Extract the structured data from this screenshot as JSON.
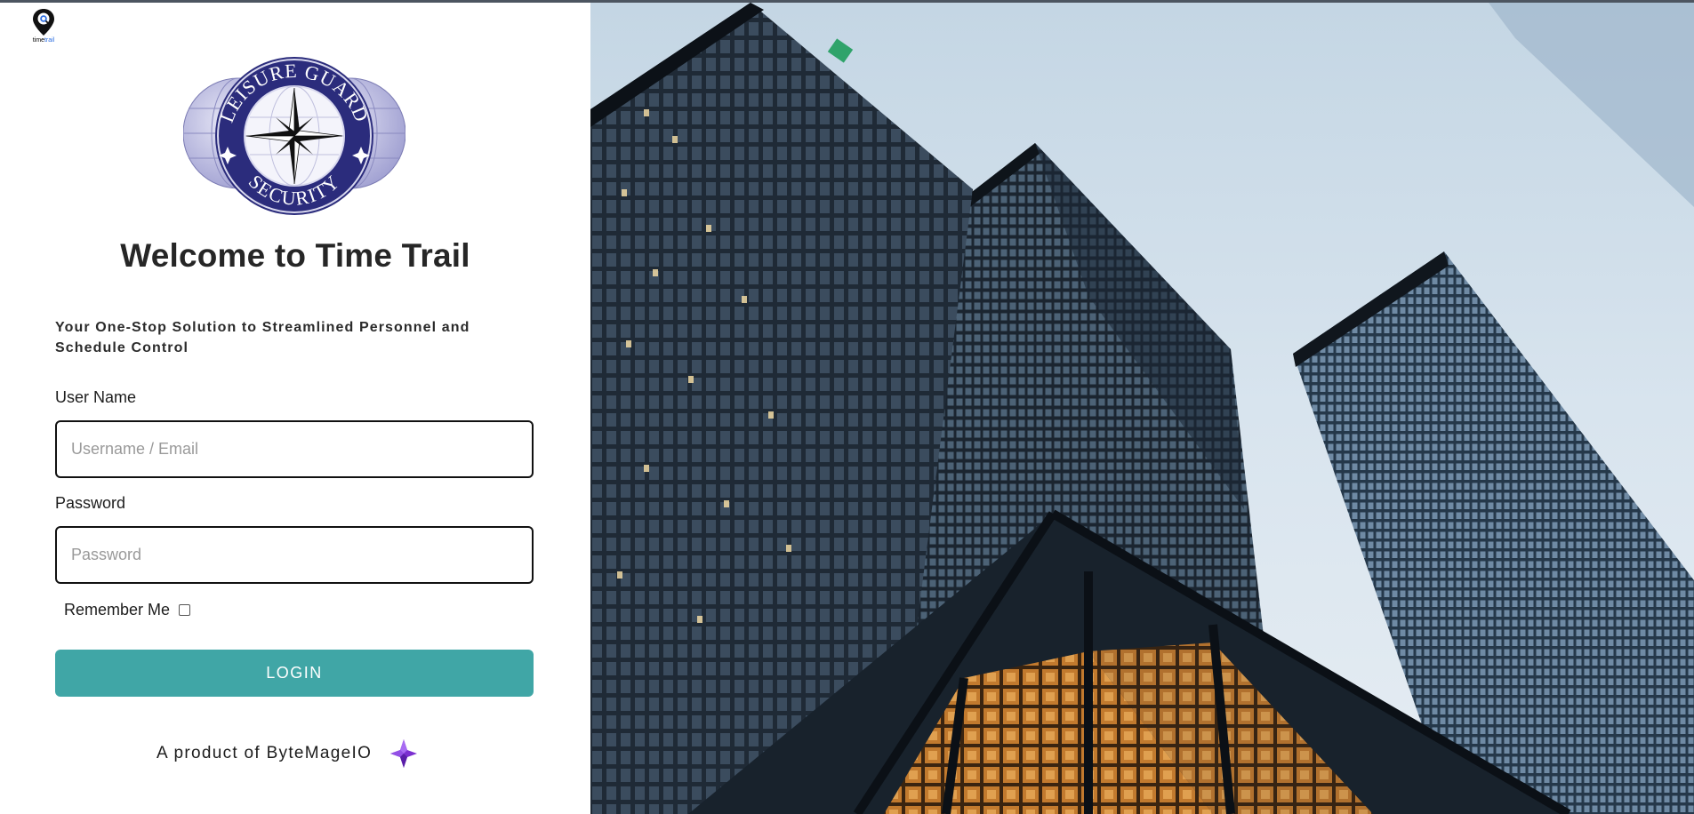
{
  "app": {
    "brand_part1": "time",
    "brand_part2": "trail",
    "icon": "map-pin-search-icon"
  },
  "organization": {
    "logo_text_top": "LEISURE GUARD",
    "logo_text_bottom": "SECURITY",
    "logo_colors": {
      "ring": "#2b2c7c",
      "globe": "#a9a9d9",
      "star": "#111111"
    }
  },
  "login": {
    "title": "Welcome to Time Trail",
    "subtitle": "Your One-Stop Solution to Streamlined Personnel and Schedule Control",
    "username_label": "User Name",
    "username_placeholder": "Username / Email",
    "username_value": "",
    "password_label": "Password",
    "password_placeholder": "Password",
    "password_value": "",
    "remember_label": "Remember Me",
    "remember_checked": false,
    "submit_label": "LOGIN"
  },
  "footer": {
    "text": "A product of ByteMageIO",
    "logo_icon": "bytemage-crystal-icon"
  },
  "colors": {
    "accent": "#40a6a6",
    "text": "#262626",
    "byte_mage": "#7b2fd0"
  },
  "hero": {
    "image": "glass-skyscrapers-photo"
  }
}
